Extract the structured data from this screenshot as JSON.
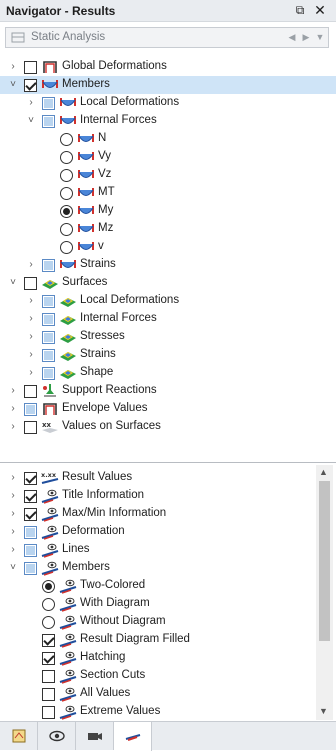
{
  "window": {
    "title": "Navigator - Results"
  },
  "combo": {
    "value": "Static Analysis"
  },
  "tree_top": [
    {
      "label": "Global Deformations",
      "expander": "›",
      "check": "off",
      "icon": "deform-icon",
      "indent": 0
    },
    {
      "label": "Members",
      "expander": "˅",
      "check": "on",
      "icon": "member-icon",
      "indent": 0,
      "selected": true
    },
    {
      "label": "Local Deformations",
      "expander": "›",
      "check": "part",
      "icon": "member-icon",
      "indent": 1
    },
    {
      "label": "Internal Forces",
      "expander": "˅",
      "check": "part",
      "icon": "member-icon",
      "indent": 1
    },
    {
      "label": "N",
      "radio": "off",
      "icon": "member-icon",
      "indent": 2
    },
    {
      "label": "Vy",
      "radio": "off",
      "icon": "member-icon",
      "indent": 2
    },
    {
      "label": "Vz",
      "radio": "off",
      "icon": "member-icon",
      "indent": 2
    },
    {
      "label": "MT",
      "radio": "off",
      "icon": "member-icon",
      "indent": 2
    },
    {
      "label": "My",
      "radio": "on",
      "icon": "member-icon",
      "indent": 2
    },
    {
      "label": "Mz",
      "radio": "off",
      "icon": "member-icon",
      "indent": 2
    },
    {
      "label": "v",
      "radio": "off",
      "icon": "member-icon",
      "indent": 2
    },
    {
      "label": "Strains",
      "expander": "›",
      "check": "part",
      "icon": "member-icon",
      "indent": 1
    },
    {
      "label": "Surfaces",
      "expander": "˅",
      "check": "off",
      "icon": "surface-icon",
      "indent": 0
    },
    {
      "label": "Local Deformations",
      "expander": "›",
      "check": "part",
      "icon": "surface-icon",
      "indent": 1
    },
    {
      "label": "Internal Forces",
      "expander": "›",
      "check": "part",
      "icon": "surface-icon",
      "indent": 1
    },
    {
      "label": "Stresses",
      "expander": "›",
      "check": "part",
      "icon": "surface-icon",
      "indent": 1
    },
    {
      "label": "Strains",
      "expander": "›",
      "check": "part",
      "icon": "surface-icon",
      "indent": 1
    },
    {
      "label": "Shape",
      "expander": "›",
      "check": "part",
      "icon": "surface-icon",
      "indent": 1
    },
    {
      "label": "Support Reactions",
      "expander": "›",
      "check": "off",
      "icon": "support-icon",
      "indent": 0
    },
    {
      "label": "Envelope Values",
      "expander": "›",
      "check": "part",
      "icon": "deform-icon",
      "indent": 0
    },
    {
      "label": "Values on Surfaces",
      "expander": "›",
      "check": "off",
      "icon": "values-icon",
      "indent": 0
    }
  ],
  "tree_bottom": [
    {
      "label": "Result Values",
      "expander": "›",
      "check": "on",
      "icon": "xxx-icon",
      "indent": 0
    },
    {
      "label": "Title Information",
      "expander": "›",
      "check": "on",
      "icon": "display-icon",
      "indent": 0
    },
    {
      "label": "Max/Min Information",
      "expander": "›",
      "check": "on",
      "icon": "display-icon",
      "indent": 0
    },
    {
      "label": "Deformation",
      "expander": "›",
      "check": "part",
      "icon": "display-icon",
      "indent": 0
    },
    {
      "label": "Lines",
      "expander": "›",
      "check": "part",
      "icon": "display-icon",
      "indent": 0
    },
    {
      "label": "Members",
      "expander": "˅",
      "check": "part",
      "icon": "display-icon",
      "indent": 0
    },
    {
      "label": "Two-Colored",
      "radio": "on",
      "icon": "display-icon",
      "indent": 1
    },
    {
      "label": "With Diagram",
      "radio": "off",
      "icon": "display-icon",
      "indent": 1
    },
    {
      "label": "Without Diagram",
      "radio": "off",
      "icon": "display-icon",
      "indent": 1
    },
    {
      "label": "Result Diagram Filled",
      "check": "on",
      "icon": "display-icon",
      "indent": 1
    },
    {
      "label": "Hatching",
      "check": "on",
      "icon": "display-icon",
      "indent": 1
    },
    {
      "label": "Section Cuts",
      "check": "off",
      "icon": "display-icon",
      "indent": 1
    },
    {
      "label": "All Values",
      "check": "off",
      "icon": "display-icon",
      "indent": 1
    },
    {
      "label": "Extreme Values",
      "check": "off",
      "icon": "display-icon",
      "indent": 1
    }
  ],
  "tabs": [
    {
      "icon": "data-icon"
    },
    {
      "icon": "eye-icon"
    },
    {
      "icon": "camera-icon"
    },
    {
      "icon": "results-icon",
      "active": true
    }
  ]
}
